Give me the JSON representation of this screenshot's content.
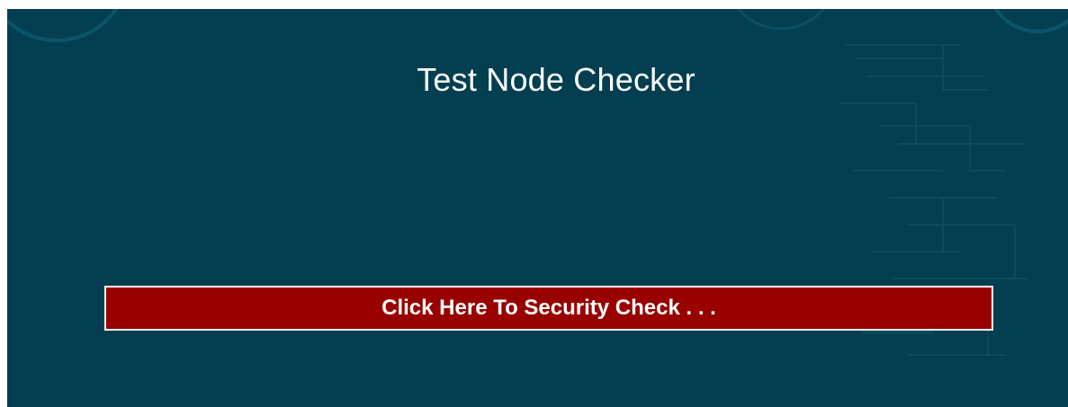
{
  "page": {
    "title": "Test Node Checker"
  },
  "action": {
    "security_check_label": "Click Here To Security Check . . ."
  },
  "colors": {
    "background": "#033f51",
    "button": "#990000",
    "text": "#ffffff"
  },
  "icons": {
    "background_decoration": "circuit-pattern"
  }
}
